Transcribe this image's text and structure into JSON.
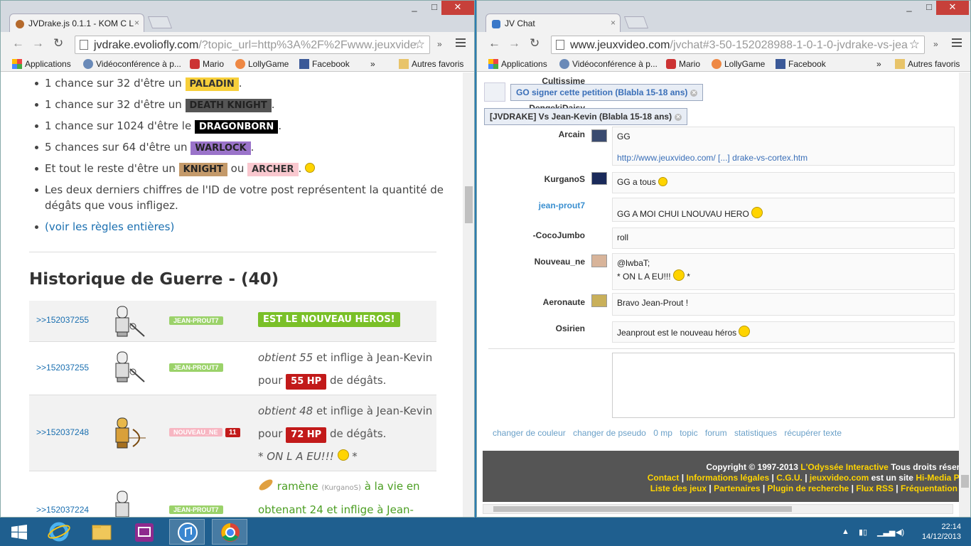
{
  "left_window": {
    "tab_title": "JVDrake.js 0.1.1 - KOM C L",
    "url_main": "jvdrake.evoliofly.com",
    "url_rest": "/?topic_url=http%3A%2F%2Fwww.jeuxvide",
    "bookmarks": [
      "Applications",
      "Vidéoconférence à p...",
      "Mario",
      "LollyGame",
      "Facebook"
    ],
    "bookmarks_more": "»",
    "other_bookmarks": "Autres favoris",
    "rules": [
      {
        "text": "1 chance sur 32 d'être un",
        "badge": "PALADIN",
        "after": "."
      },
      {
        "text": "1 chance sur 32 d'être un",
        "badge": "DEATH KNIGHT",
        "after": "."
      },
      {
        "text": "1 chance sur 1024 d'être le",
        "badge": "DRAGONBORN",
        "after": "."
      },
      {
        "text": "5 chances sur 64 d'être un",
        "badge": "WARLOCK",
        "after": "."
      }
    ],
    "rest_rule": {
      "text": "Et tout le reste d'être un",
      "badge1": "KNIGHT",
      "or": "ou",
      "badge2": "ARCHER",
      "after": "."
    },
    "damage_rule_line1": "Les deux derniers chiffres de l'ID de votre post représentent la quantité de",
    "damage_rule_line2": "dégâts que vous infligez.",
    "rules_link": "(voir les règles entières)",
    "history_title": "Historique de Guerre - (40)",
    "history": [
      {
        "post_id": ">>152037255",
        "player": "JEAN-PROUT7",
        "result": "EST LE NOUVEAU HEROS!"
      },
      {
        "post_id": ">>152037255",
        "player": "JEAN-PROUT7",
        "obtains": "obtient 55",
        "mid": "et inflige à Jean-Kevin",
        "pour": "pour",
        "hp": "55 HP",
        "tail": "de dégâts."
      },
      {
        "post_id": ">>152037248",
        "player": "NOUVEAU_NE",
        "count": "11",
        "obtains": "obtient 48",
        "mid": "et inflige à Jean-Kevin",
        "pour": "pour",
        "hp": "72 HP",
        "tail": "de dégâts.",
        "quote": "* ON L A EU!!!",
        "quote_end": "*"
      },
      {
        "post_id": ">>152037224",
        "player": "JEAN-PROUT7",
        "line1_a": "ramène",
        "line1_b": "(KurganoS)",
        "line1_c": "à la vie en",
        "line2": "obtenant 24 et inflige à Jean-"
      }
    ]
  },
  "right_window": {
    "tab_title": "JV Chat",
    "url_main": "www.jeuxvideo.com",
    "url_rest": "/jvchat#3-50-152028988-1-0-1-0-jvdrake-vs-jea",
    "bookmarks": [
      "Applications",
      "Vidéoconférence à p...",
      "Mario",
      "LollyGame",
      "Facebook"
    ],
    "bookmarks_more": "»",
    "other_bookmarks": "Autres favoris",
    "overlays": [
      "GO signer cette petition (Blabla 15-18 ans)",
      "[JVDRAKE] Vs Jean-Kevin (Blabla 15-18 ans)"
    ],
    "partial_nicks": [
      "Cultissime",
      "DengekiDaisy"
    ],
    "messages": [
      {
        "nick": "Arcain",
        "text": "GG",
        "link": "http://www.jeuxvideo.com/ [...] drake-vs-cortex.htm"
      },
      {
        "nick": "KurganoS",
        "text": "GG a tous"
      },
      {
        "nick": "jean-prout7",
        "text": "GG A MOI CHUI LNOUVAU HERO"
      },
      {
        "nick": "-CocoJumbo",
        "text": "roll"
      },
      {
        "nick": "Nouveau_ne",
        "text": "@lwbaT;",
        "text2": "* ON L A EU!!!",
        "text2_end": "*"
      },
      {
        "nick": "Aeronaute",
        "text": "Bravo Jean-Prout !"
      },
      {
        "nick": "Osirien",
        "text": "Jeanprout est le nouveau héros"
      }
    ],
    "bottom_links": [
      "changer de couleur",
      "changer de pseudo",
      "0 mp",
      "topic",
      "forum",
      "statistiques",
      "récupérer texte"
    ],
    "footer_line1_a": "Copyright © 1997-2013",
    "footer_line1_b": "L'Odyssée Interactive",
    "footer_line1_c": "Tous droits réserv",
    "footer_line2": [
      "Contact",
      "Informations légales",
      "C.G.U.",
      "jeuxvideo.com",
      "est un site",
      "Hi-Media Pu"
    ],
    "footer_line3": [
      "Liste des jeux",
      "Partenaires",
      "Plugin de recherche",
      "Flux RSS",
      "Fréquentation c"
    ]
  },
  "taskbar": {
    "time": "22:14",
    "date": "14/12/2013"
  },
  "colors": {
    "paladin": "#f7cf3a",
    "death_knight": "#555555",
    "dragonborn": "#000000",
    "warlock": "#9a73c9",
    "knight": "#c49a6a",
    "archer": "#f9c8cf",
    "hp": "#c21a1a",
    "hero": "#7ac028"
  }
}
